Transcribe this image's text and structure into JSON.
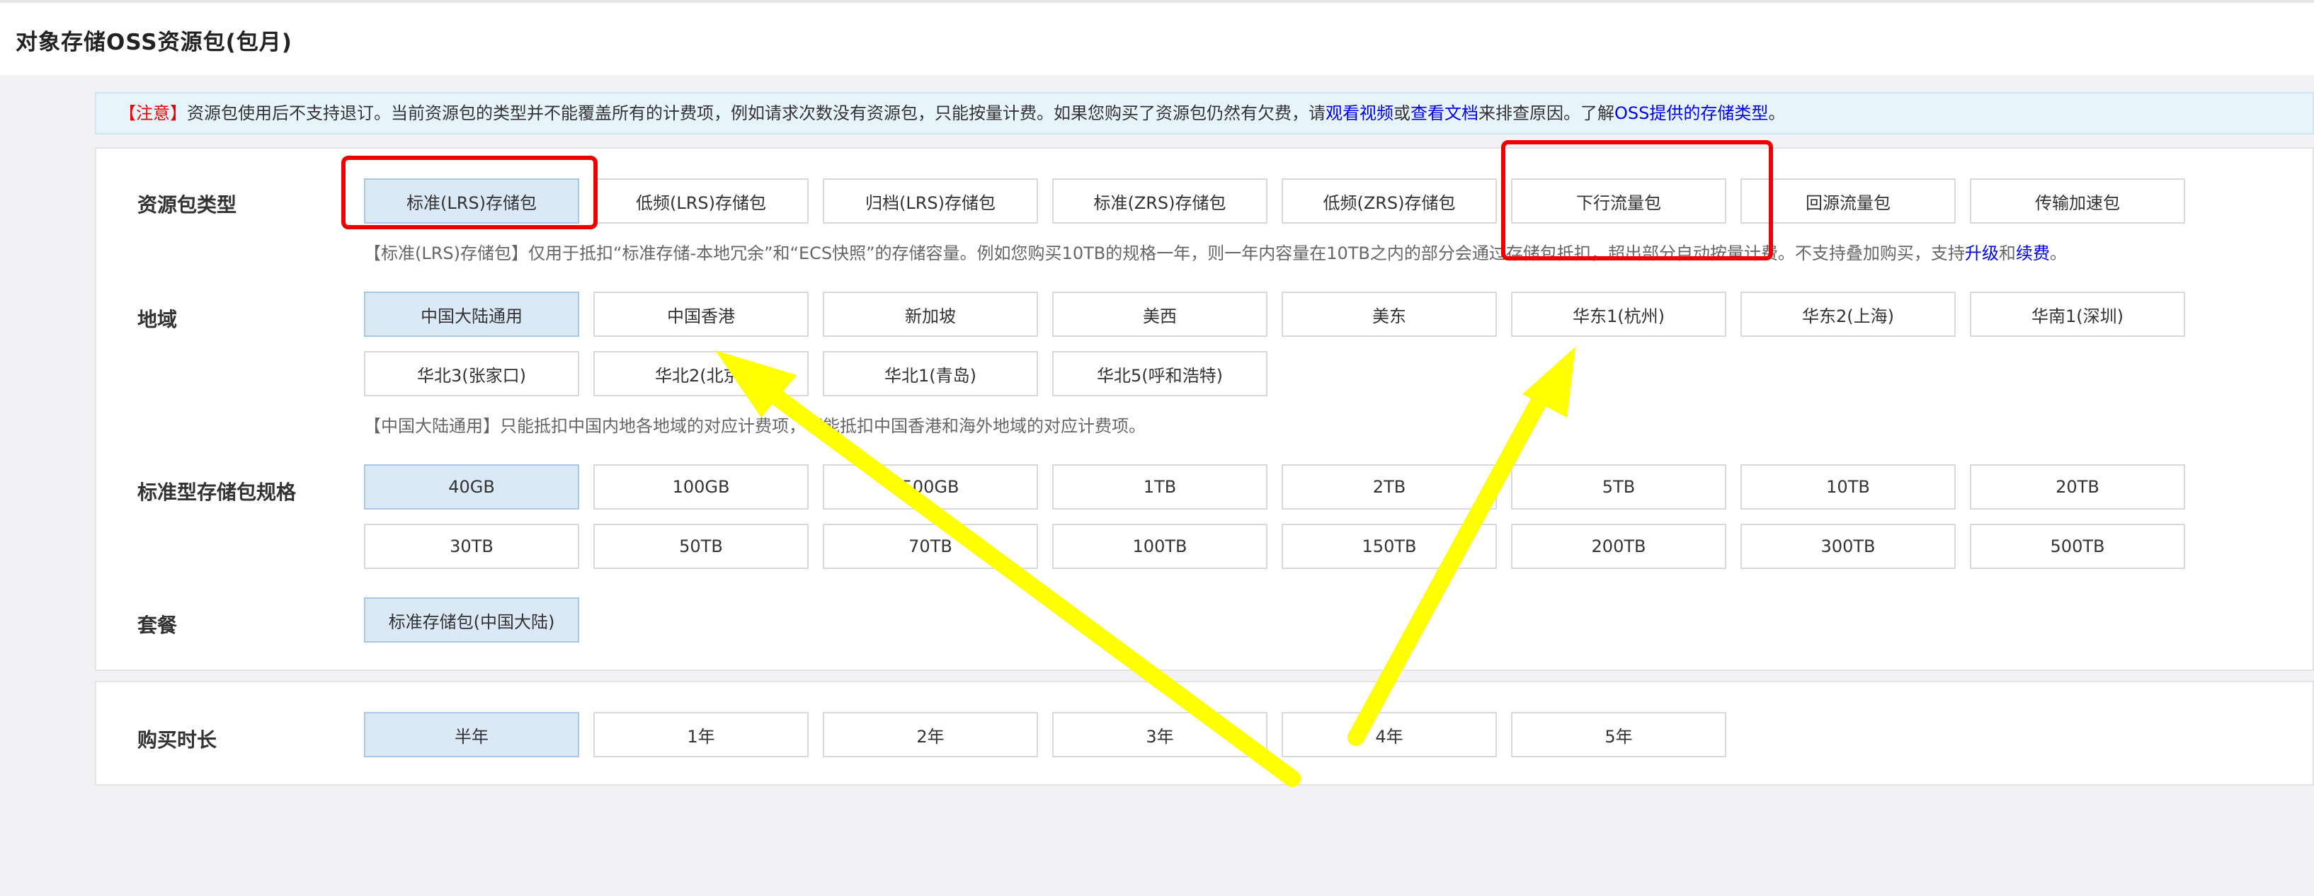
{
  "page_title": "对象存储OSS资源包(包月)",
  "notice": {
    "tag": "【注意】",
    "text1": "资源包使用后不支持退订。当前资源包的类型并不能覆盖所有的计费项，例如请求次数没有资源包，只能按量计费。如果您购买了资源包仍然有欠费，请",
    "link1": "观看视频",
    "or": "或",
    "link2": "查看文档",
    "text2": "来排查原因。了解",
    "link3": "OSS提供的存储类型",
    "end": "。"
  },
  "package_type": {
    "label": "资源包类型",
    "options": [
      "标准(LRS)存储包",
      "低频(LRS)存储包",
      "归档(LRS)存储包",
      "标准(ZRS)存储包",
      "低频(ZRS)存储包",
      "下行流量包",
      "回源流量包",
      "传输加速包"
    ],
    "desc_text": "【标准(LRS)存储包】仅用于抵扣“标准存储-本地冗余”和“ECS快照”的存储容量。例如您购买10TB的规格一年，则一年内容量在10TB之内的部分会通过存储包抵扣，超出部分自动按量计费。不支持叠加购买，支持",
    "desc_link1": "升级",
    "desc_and": "和",
    "desc_link2": "续费",
    "desc_end": "。"
  },
  "region": {
    "label": "地域",
    "row1": [
      "中国大陆通用",
      "中国香港",
      "新加坡",
      "美西",
      "美东",
      "华东1(杭州)",
      "华东2(上海)",
      "华南1(深圳)"
    ],
    "row2": [
      "华北3(张家口)",
      "华北2(北京)",
      "华北1(青岛)",
      "华北5(呼和浩特)"
    ],
    "desc": "【中国大陆通用】只能抵扣中国内地各地域的对应计费项，不能抵扣中国香港和海外地域的对应计费项。"
  },
  "spec": {
    "label": "标准型存储包规格",
    "row1": [
      "40GB",
      "100GB",
      "500GB",
      "1TB",
      "2TB",
      "5TB",
      "10TB",
      "20TB"
    ],
    "row2": [
      "30TB",
      "50TB",
      "70TB",
      "100TB",
      "150TB",
      "200TB",
      "300TB",
      "500TB"
    ]
  },
  "plan": {
    "label": "套餐",
    "option": "标准存储包(中国大陆)"
  },
  "duration": {
    "label": "购买时长",
    "options": [
      "半年",
      "1年",
      "2年",
      "3年",
      "4年",
      "5年"
    ]
  },
  "annotation_colors": {
    "box": "#ee0000",
    "arrow": "#ffff00"
  }
}
